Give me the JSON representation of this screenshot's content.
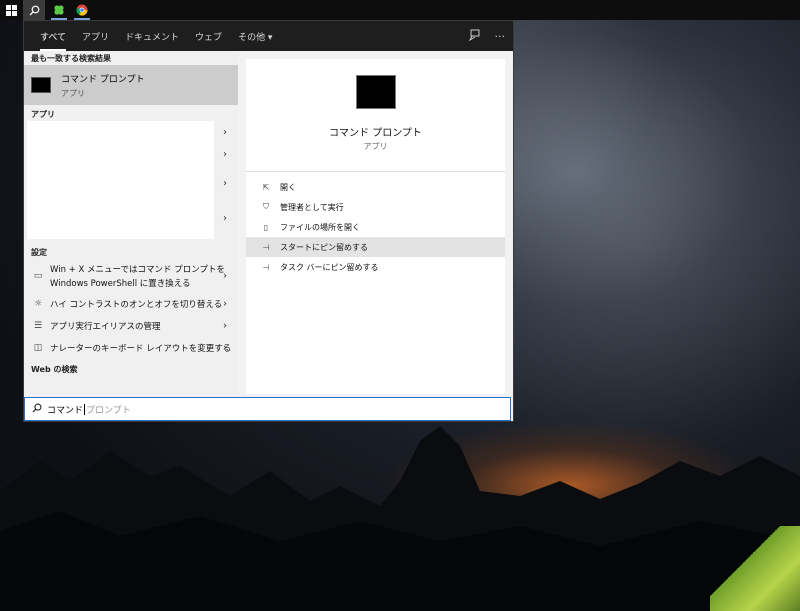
{
  "taskbar": {
    "items": [
      {
        "icon": "windows-logo-icon"
      },
      {
        "icon": "search-icon"
      },
      {
        "icon": "clover-app-icon"
      },
      {
        "icon": "chrome-icon"
      }
    ]
  },
  "search": {
    "tabs": [
      "すべて",
      "アプリ",
      "ドキュメント",
      "ウェブ",
      "その他 ▾"
    ],
    "active_tab": 0,
    "best_match_heading": "最も一致する検索結果",
    "best_match": {
      "title": "コマンド プロンプト",
      "subtitle": "アプリ"
    },
    "apps_heading": "アプリ",
    "settings_heading": "設定",
    "settings_items": [
      {
        "label_line1": "Win + X メニューではコマンド プロンプトを",
        "label_line2": "Windows PowerShell に置き換える",
        "icon": "monitor-icon"
      },
      {
        "label_line1": "ハイ コントラストのオンとオフを切り替える",
        "icon": "brightness-icon"
      },
      {
        "label_line1": "アプリ実行エイリアスの管理",
        "icon": "list-icon"
      },
      {
        "label_line1": "ナレーターのキーボード レイアウトを変更する",
        "icon": "narrator-icon"
      }
    ],
    "web_heading": "Web の検索",
    "detail": {
      "title": "コマンド プロンプト",
      "subtitle": "アプリ",
      "actions": [
        "開く",
        "管理者として実行",
        "ファイルの場所を開く",
        "スタートにピン留めする",
        "タスク バーにピン留めする"
      ],
      "highlighted_action": 3
    },
    "query_typed": "コマンド",
    "query_suggestion": "プロンプト"
  },
  "colors": {
    "accent": "#2b6fd0",
    "panel_bg": "#f2f2f2",
    "topbar_bg": "#1e1e1e"
  }
}
